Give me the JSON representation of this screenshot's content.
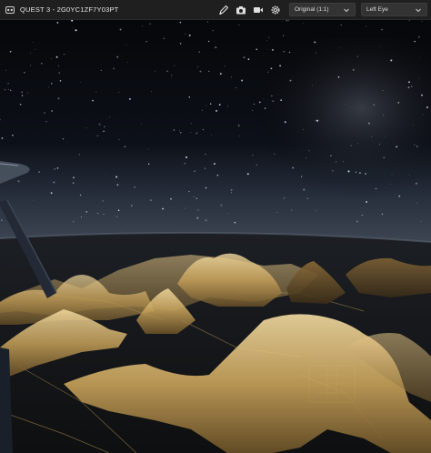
{
  "toolbar": {
    "title": "QUEST 3 - 2G0YC1ZF7Y03PT",
    "icons": [
      "pen-icon",
      "camera-icon",
      "record-icon",
      "settings-icon"
    ],
    "resolution_select": {
      "value": "Original (1:1)"
    },
    "eye_select": {
      "value": "Left Eye"
    }
  },
  "colors": {
    "toolbar_bg": "#1f1f1f",
    "select_bg": "#333333",
    "text": "#e6e6e6"
  }
}
